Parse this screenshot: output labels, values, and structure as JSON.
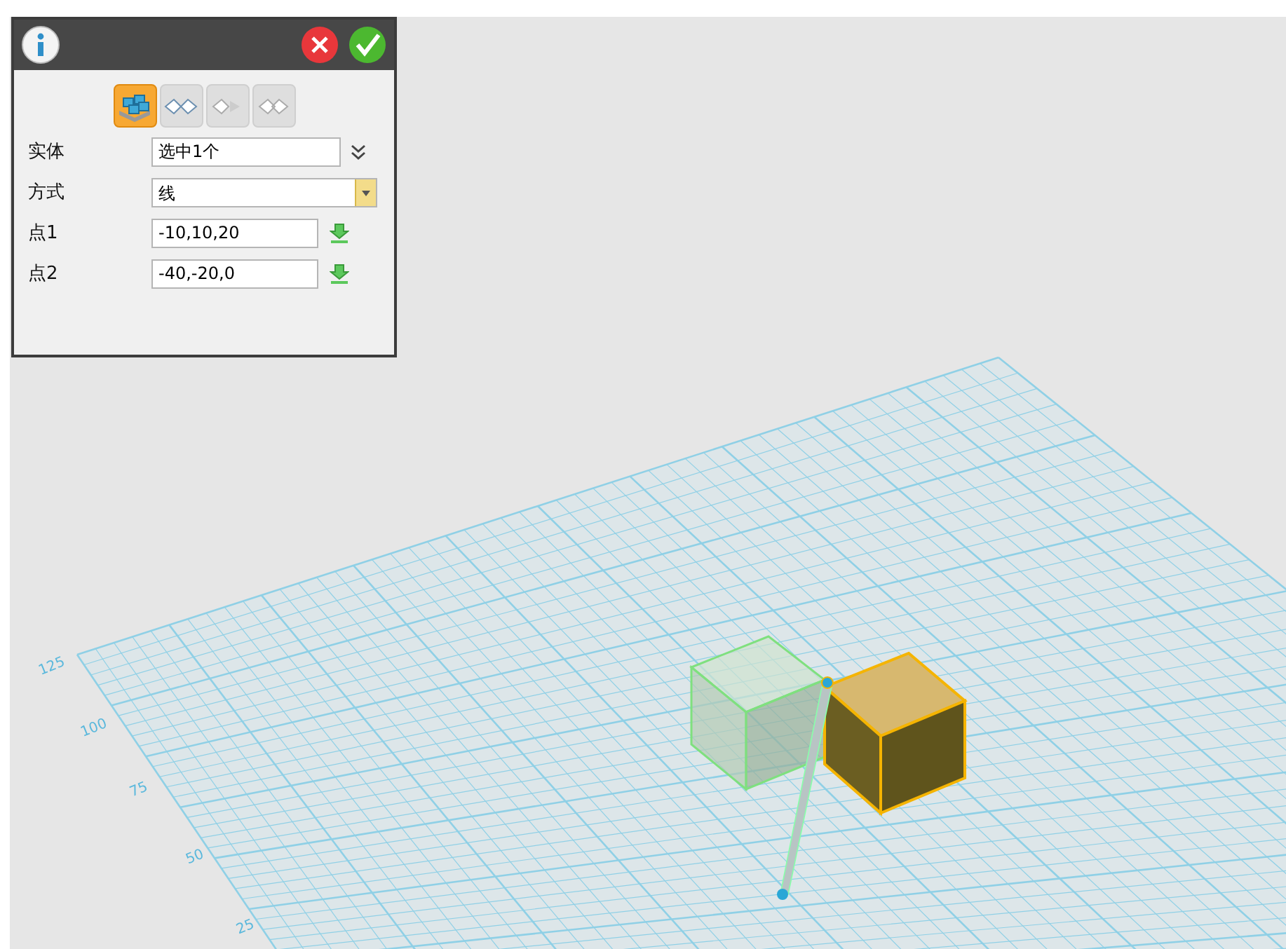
{
  "panel": {
    "mode_buttons": [
      {
        "kind": "solid",
        "selected": true
      },
      {
        "kind": "pair",
        "selected": false
      },
      {
        "kind": "shift",
        "selected": false
      },
      {
        "kind": "merge",
        "selected": false
      }
    ],
    "rows": [
      {
        "kind": "selection",
        "label": "实体",
        "value": "选中1个"
      },
      {
        "kind": "dropdown",
        "label": "方式",
        "value": "线"
      },
      {
        "kind": "point",
        "label": "点1",
        "value": "-10,10,20"
      },
      {
        "kind": "point",
        "label": "点2",
        "value": "-40,-20,0"
      }
    ]
  },
  "viewport": {
    "axis_labels": [
      "125",
      "100",
      "75",
      "50",
      "25"
    ]
  }
}
